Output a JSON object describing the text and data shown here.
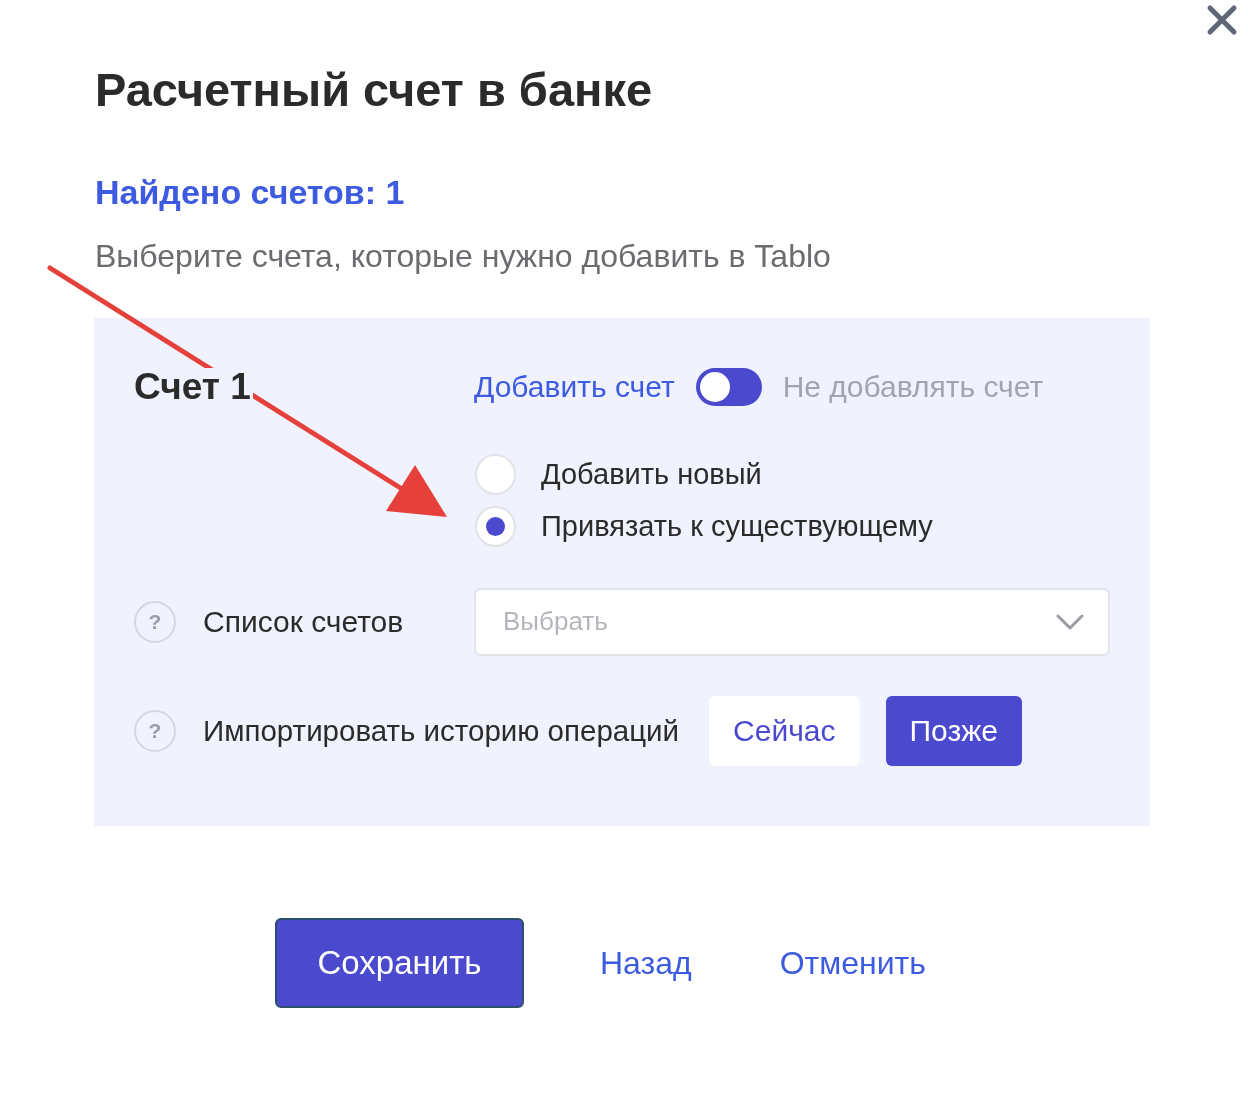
{
  "title": "Расчетный счет в банке",
  "found_label": "Найдено счетов: 1",
  "instruction": "Выберите счета, которые нужно добавить в Tablo",
  "accounts": [
    {
      "name": "Счет 1",
      "toggle": {
        "left_label": "Добавить счет",
        "right_label": "Не добавлять счет",
        "on": false
      },
      "options": [
        {
          "label": "Добавить новый",
          "selected": false
        },
        {
          "label": "Привязать к существующему",
          "selected": true
        }
      ],
      "account_list": {
        "help": "?",
        "label": "Список счетов",
        "placeholder": "Выбрать"
      },
      "import_history": {
        "help": "?",
        "label": "Импортировать историю операций",
        "choices": [
          {
            "label": "Сейчас",
            "selected": false
          },
          {
            "label": "Позже",
            "selected": true
          }
        ]
      }
    }
  ],
  "footer_buttons": [
    {
      "label": "Сохранить",
      "kind": "primary"
    },
    {
      "label": "Назад",
      "kind": "link"
    },
    {
      "label": "Отменить",
      "kind": "link"
    }
  ]
}
